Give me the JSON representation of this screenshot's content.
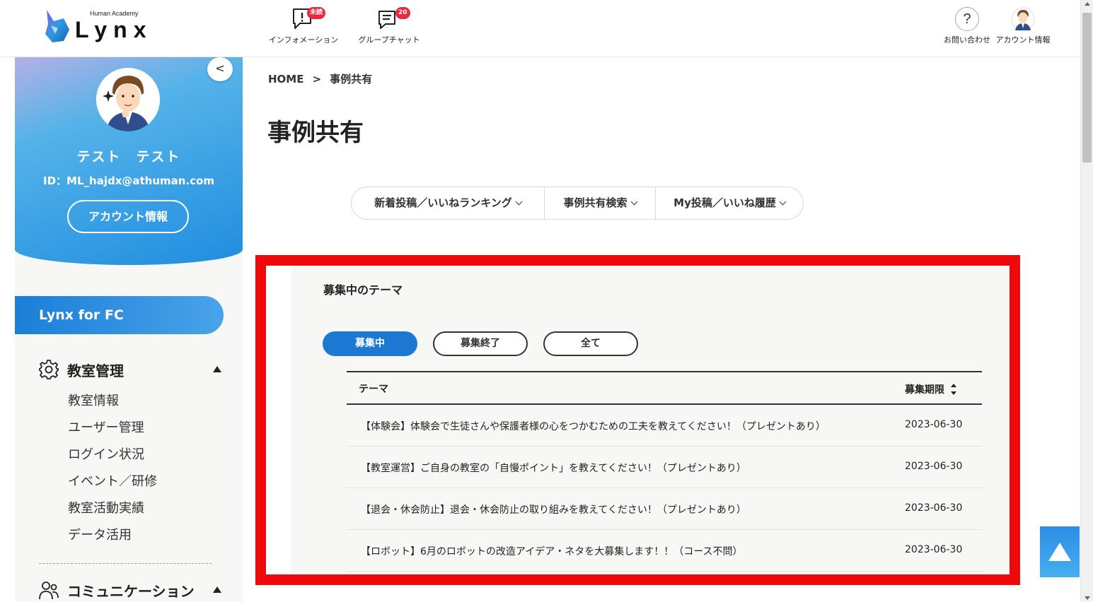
{
  "header": {
    "logo_small": "Human Academy",
    "logo_big": "Lynx",
    "nav": [
      {
        "label": "インフォメーション",
        "badge": "未読",
        "icon": "speech-bubble-exclamation-icon"
      },
      {
        "label": "グループチャット",
        "badge": "20",
        "icon": "chat-icon"
      },
      {
        "label": "お問い合わせ",
        "icon": "question-icon"
      },
      {
        "label": "アカウント情報",
        "icon": "user-avatar-icon"
      }
    ]
  },
  "sidebar": {
    "user_name": "テスト　テスト",
    "user_id": "ID：ML_hajdx@athuman.com",
    "account_button": "アカウント情報",
    "collapse_icon": "chevron-left-icon",
    "brand_button": "Lynx for FC",
    "sections": [
      {
        "title": "教室管理",
        "icon": "gear-icon",
        "items": [
          "教室情報",
          "ユーザー管理",
          "ログイン状況",
          "イベント／研修",
          "教室活動実績",
          "データ活用"
        ]
      },
      {
        "title": "コミュニケーション",
        "icon": "people-icon"
      }
    ]
  },
  "breadcrumb": {
    "home": "HOME",
    "separator": ">",
    "current": "事例共有"
  },
  "page_title": "事例共有",
  "tabs": [
    "新着投稿／いいねランキング",
    "事例共有検索",
    "My投稿／いいね履歴"
  ],
  "panel": {
    "title": "募集中のテーマ",
    "filters": [
      "募集中",
      "募集終了",
      "全て"
    ],
    "table": {
      "headers": [
        "テーマ",
        "募集期限"
      ],
      "rows": [
        {
          "theme": "【体験会】体験会で生徒さんや保護者様の心をつかむための工夫を教えてください！（プレゼントあり）",
          "deadline": "2023-06-30"
        },
        {
          "theme": "【教室運営】ご自身の教室の「自慢ポイント」を教えてください！（プレゼントあり）",
          "deadline": "2023-06-30"
        },
        {
          "theme": "【退会・休会防止】退会・休会防止の取り組みを教えてください！（プレゼントあり）",
          "deadline": "2023-06-30"
        },
        {
          "theme": "【ロボット】6月のロボットの改造アイデア・ネタを大募集します！！（コース不問）",
          "deadline": "2023-06-30"
        }
      ]
    }
  },
  "colors": {
    "accent": "#1d78d4",
    "highlight_frame": "#ee0a0a",
    "badge": "#e8283c"
  },
  "scroll_top_icon": "arrow-up-icon"
}
